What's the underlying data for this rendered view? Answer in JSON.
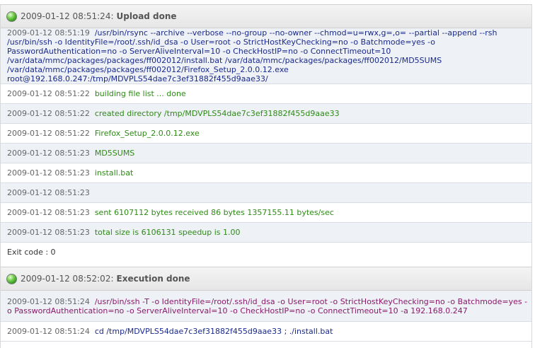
{
  "upload": {
    "timestamp": "2009-01-12 08:51:24:",
    "title": "Upload done",
    "icon": "green-status-icon",
    "rows": [
      {
        "ts": "2009-01-12 08:51:19",
        "text": "/usr/bin/rsync --archive --verbose --no-group --no-owner --chmod=u=rwx,g=,o= --partial --append --rsh /usr/bin/ssh -o IdentityFile=/root/.ssh/id_dsa -o User=root -o StrictHostKeyChecking=no -o Batchmode=yes -o PasswordAuthentication=no -o ServerAliveInterval=10 -o CheckHostIP=no -o ConnectTimeout=10 /var/data/mmc/packages/packages/ff002012/install.bat /var/data/mmc/packages/packages/ff002012/MD5SUMS /var/data/mmc/packages/packages/ff002012/Firefox_Setup_2.0.0.12.exe root@192.168.0.247:/tmp/MDVPLS54dae7c3ef31882f455d9aae33/"
      },
      {
        "ts": "2009-01-12 08:51:22",
        "text": "building file list ... done"
      },
      {
        "ts": "2009-01-12 08:51:22",
        "text": "created directory /tmp/MDVPLS54dae7c3ef31882f455d9aae33"
      },
      {
        "ts": "2009-01-12 08:51:22",
        "text": "Firefox_Setup_2.0.0.12.exe"
      },
      {
        "ts": "2009-01-12 08:51:23",
        "text": "MD5SUMS"
      },
      {
        "ts": "2009-01-12 08:51:23",
        "text": "install.bat"
      },
      {
        "ts": "2009-01-12 08:51:23",
        "text": ""
      },
      {
        "ts": "2009-01-12 08:51:23",
        "text": "sent 6107112 bytes received 86 bytes 1357155.11 bytes/sec"
      },
      {
        "ts": "2009-01-12 08:51:23",
        "text": "total size is 6106131 speedup is 1.00"
      }
    ],
    "exit_code": "Exit code : 0"
  },
  "execution": {
    "timestamp": "2009-01-12 08:52:02:",
    "title": "Execution done",
    "icon": "green-status-icon",
    "rows": [
      {
        "ts": "2009-01-12 08:51:24",
        "text": "/usr/bin/ssh -T -o IdentityFile=/root/.ssh/id_dsa -o User=root -o StrictHostKeyChecking=no -o Batchmode=yes -o PasswordAuthentication=no -o ServerAliveInterval=10 -o CheckHostIP=no -o ConnectTimeout=10 -a 192.168.0.247"
      },
      {
        "ts": "2009-01-12 08:51:24",
        "text": "cd /tmp/MDVPLS54dae7c3ef31882f455d9aae33 ; ./install.bat"
      }
    ]
  },
  "colors": {
    "command": "#1a2a8c",
    "output": "#2e8a16",
    "ssh_command": "#8a1a6a",
    "row_alt_bg": "#eef1f6"
  }
}
